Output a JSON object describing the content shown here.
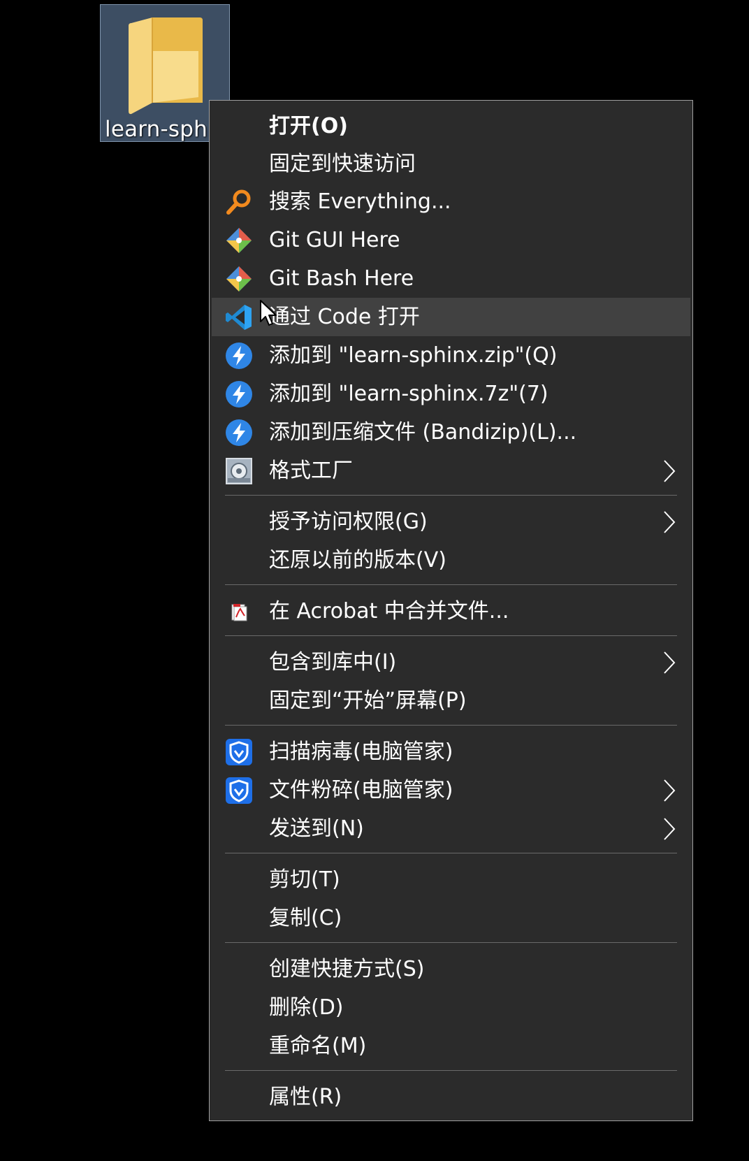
{
  "desktop": {
    "folder_name": "learn-sphinx"
  },
  "menu": {
    "items": [
      {
        "label": "打开(O)",
        "icon": "none",
        "bold": true
      },
      {
        "label": "固定到快速访问",
        "icon": "none"
      },
      {
        "label": "搜索 Everything...",
        "icon": "search-everything-icon"
      },
      {
        "label": "Git GUI Here",
        "icon": "git-icon"
      },
      {
        "label": "Git Bash Here",
        "icon": "git-icon"
      },
      {
        "label": "通过 Code 打开",
        "icon": "vscode-icon",
        "highlighted": true
      },
      {
        "label": "添加到 \"learn-sphinx.zip\"(Q)",
        "icon": "bandizip-icon"
      },
      {
        "label": "添加到 \"learn-sphinx.7z\"(7)",
        "icon": "bandizip-icon"
      },
      {
        "label": "添加到压缩文件 (Bandizip)(L)...",
        "icon": "bandizip-icon"
      },
      {
        "label": "格式工厂",
        "icon": "format-factory-icon",
        "submenu": true
      },
      {
        "label": "授予访问权限(G)",
        "icon": "none",
        "submenu": true
      },
      {
        "label": "还原以前的版本(V)",
        "icon": "none"
      },
      {
        "label": "在 Acrobat 中合并文件...",
        "icon": "acrobat-icon"
      },
      {
        "label": "包含到库中(I)",
        "icon": "none",
        "submenu": true
      },
      {
        "label": "固定到“开始”屏幕(P)",
        "icon": "none"
      },
      {
        "label": "扫描病毒(电脑管家)",
        "icon": "tencent-pc-manager-icon"
      },
      {
        "label": "文件粉碎(电脑管家)",
        "icon": "tencent-pc-manager-icon",
        "submenu": true
      },
      {
        "label": "发送到(N)",
        "icon": "none",
        "submenu": true
      },
      {
        "label": "剪切(T)",
        "icon": "none"
      },
      {
        "label": "复制(C)",
        "icon": "none"
      },
      {
        "label": "创建快捷方式(S)",
        "icon": "none"
      },
      {
        "label": "删除(D)",
        "icon": "none"
      },
      {
        "label": "重命名(M)",
        "icon": "none"
      },
      {
        "label": "属性(R)",
        "icon": "none"
      }
    ]
  },
  "colors": {
    "menu_background": "#2b2b2b",
    "menu_hover": "#414141",
    "separator": "#6a6a6a",
    "selection": "#3d4e63",
    "text": "#ffffff"
  }
}
